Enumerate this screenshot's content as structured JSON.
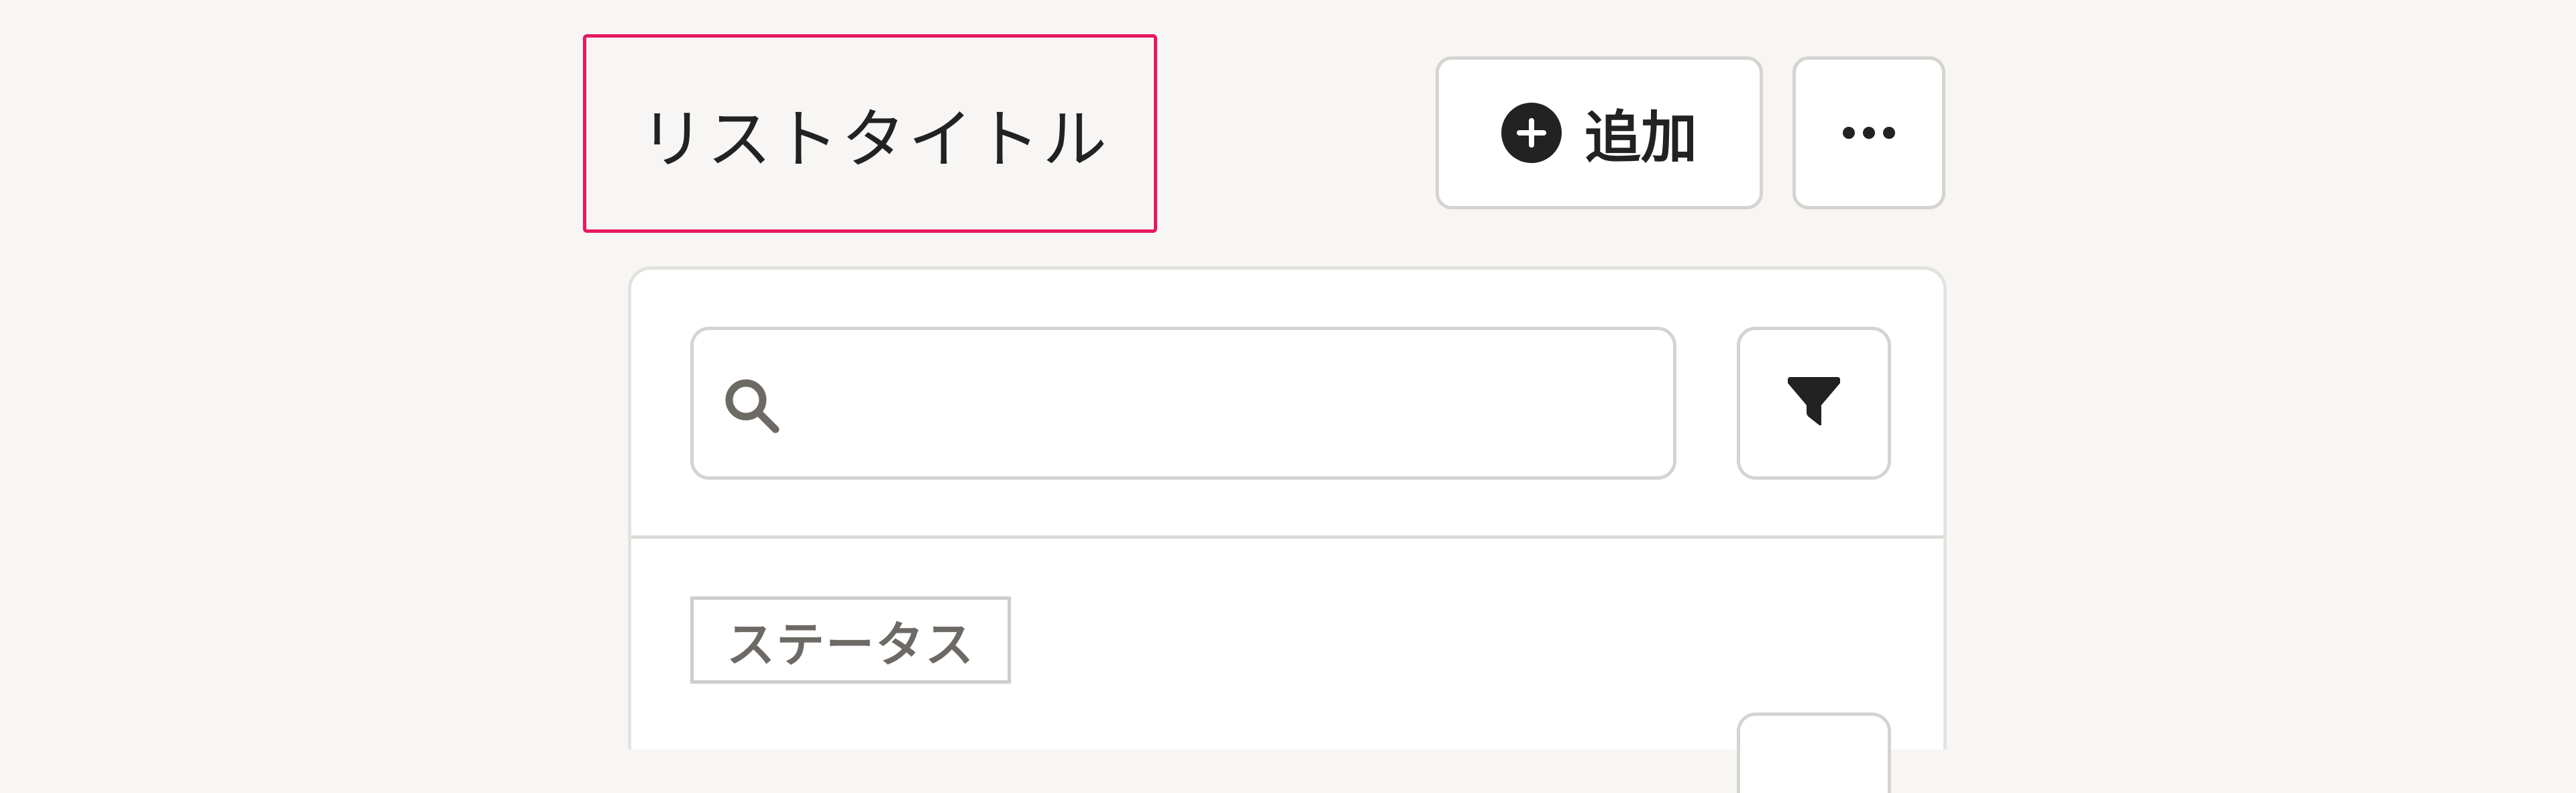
{
  "header": {
    "title": "リストタイトル",
    "add_button_label": "追加",
    "add_icon": "plus-circle-icon",
    "more_icon": "ellipsis-icon"
  },
  "panel": {
    "search": {
      "value": "",
      "placeholder": "",
      "icon": "search-icon"
    },
    "filter_icon": "filter-icon",
    "status_label": "ステータス"
  },
  "colors": {
    "background": "#f7f6f4",
    "highlight_border": "#e8185f",
    "dark": "#222222",
    "muted_text": "#6d6a66",
    "border": "#d6d4d1"
  }
}
